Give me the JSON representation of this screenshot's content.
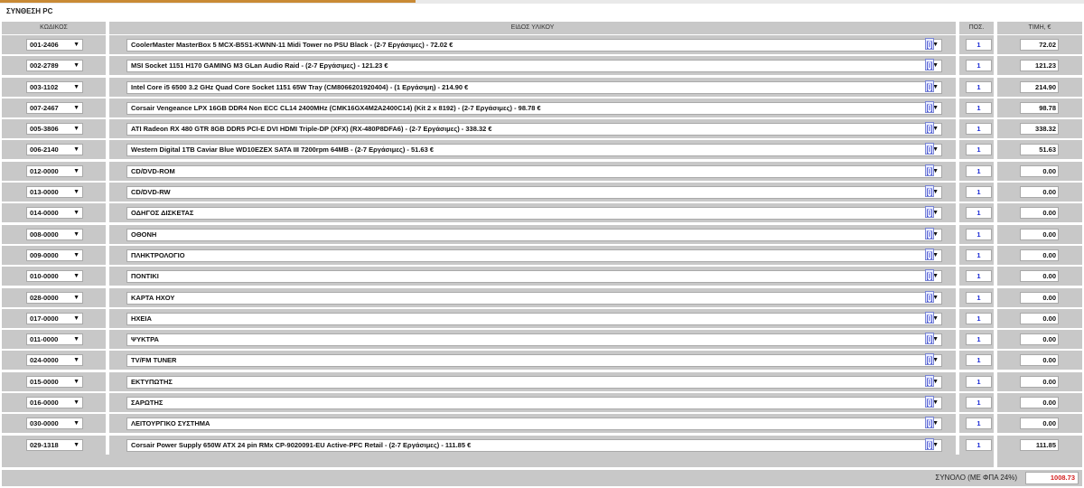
{
  "page_title": "ΣΥΝΘΕΣΗ PC",
  "columns": {
    "code": "ΚΩΔΙΚΟΣ",
    "item": "ΕΙΔΟΣ ΥΛΙΚΟΥ",
    "qty": "ΠΟΣ.",
    "price": "ΤΙΜΗ, €"
  },
  "info_label": "[i]",
  "dropdown_glyph": "▼",
  "rows": [
    {
      "code": "001-2406",
      "item": "CoolerMaster MasterBox 5 MCX-B5S1-KWNN-11 Midi Tower no PSU Black - (2-7 Εργάσιμες) - 72.02 €",
      "qty": "1",
      "price": "72.02"
    },
    {
      "code": "002-2789",
      "item": "MSI Socket 1151 H170 GAMING M3 GLan Audio Raid - (2-7 Εργάσιμες) - 121.23 €",
      "qty": "1",
      "price": "121.23"
    },
    {
      "code": "003-1102",
      "item": "Intel Core i5 6500 3.2 GHz Quad Core Socket 1151 65W Tray (CM8066201920404) - (1 Εργάσιμη) - 214.90 €",
      "qty": "1",
      "price": "214.90"
    },
    {
      "code": "007-2467",
      "item": "Corsair Vengeance LPX 16GB DDR4 Non ECC CL14 2400MHz (CMK16GX4M2A2400C14) (Kit 2 x 8192) - (2-7 Εργάσιμες) - 98.78 €",
      "qty": "1",
      "price": "98.78"
    },
    {
      "code": "005-3806",
      "item": "ATI Radeon RX 480 GTR 8GB DDR5 PCI-E DVI HDMI Triple-DP (XFX) (RX-480P8DFA6) - (2-7 Εργάσιμες) - 338.32 €",
      "qty": "1",
      "price": "338.32"
    },
    {
      "code": "006-2140",
      "item": "Western Digital 1TB Caviar Blue WD10EZEX SATA III 7200rpm 64MB - (2-7 Εργάσιμες) - 51.63 €",
      "qty": "1",
      "price": "51.63"
    },
    {
      "code": "012-0000",
      "item": "CD/DVD-ROM",
      "qty": "1",
      "price": "0.00"
    },
    {
      "code": "013-0000",
      "item": "CD/DVD-RW",
      "qty": "1",
      "price": "0.00"
    },
    {
      "code": "014-0000",
      "item": "ΟΔΗΓΟΣ ΔΙΣΚΕΤΑΣ",
      "qty": "1",
      "price": "0.00"
    },
    {
      "code": "008-0000",
      "item": "ΟΘΟΝΗ",
      "qty": "1",
      "price": "0.00"
    },
    {
      "code": "009-0000",
      "item": "ΠΛΗΚΤΡΟΛΟΓΙΟ",
      "qty": "1",
      "price": "0.00"
    },
    {
      "code": "010-0000",
      "item": "ΠΟΝΤΙΚΙ",
      "qty": "1",
      "price": "0.00"
    },
    {
      "code": "028-0000",
      "item": "ΚΑΡΤΑ ΗΧΟΥ",
      "qty": "1",
      "price": "0.00"
    },
    {
      "code": "017-0000",
      "item": "ΗΧΕΙΑ",
      "qty": "1",
      "price": "0.00"
    },
    {
      "code": "011-0000",
      "item": "ΨΥΚΤΡΑ",
      "qty": "1",
      "price": "0.00"
    },
    {
      "code": "024-0000",
      "item": "TV/FM TUNER",
      "qty": "1",
      "price": "0.00"
    },
    {
      "code": "015-0000",
      "item": "ΕΚΤΥΠΩΤΗΣ",
      "qty": "1",
      "price": "0.00"
    },
    {
      "code": "016-0000",
      "item": "ΣΑΡΩΤΗΣ",
      "qty": "1",
      "price": "0.00"
    },
    {
      "code": "030-0000",
      "item": "ΛΕΙΤΟΥΡΓΙΚΟ ΣΥΣΤΗΜΑ",
      "qty": "1",
      "price": "0.00"
    },
    {
      "code": "029-1318",
      "item": "Corsair Power Supply 650W ATX 24 pin RMx CP-9020091-EU Active-PFC Retail - (2-7 Εργάσιμες) - 111.85 €",
      "qty": "1",
      "price": "111.85"
    }
  ],
  "total": {
    "label": "ΣΥΝΟΛΟ (ΜΕ ΦΠΑ 24%)",
    "value": "1008.73"
  },
  "colors": {
    "accent": "#c98a35",
    "cell_bg": "#c8c8c8",
    "qty_text": "#1b2bd6",
    "total_text": "#d42020",
    "info_link": "#2a35c9"
  }
}
